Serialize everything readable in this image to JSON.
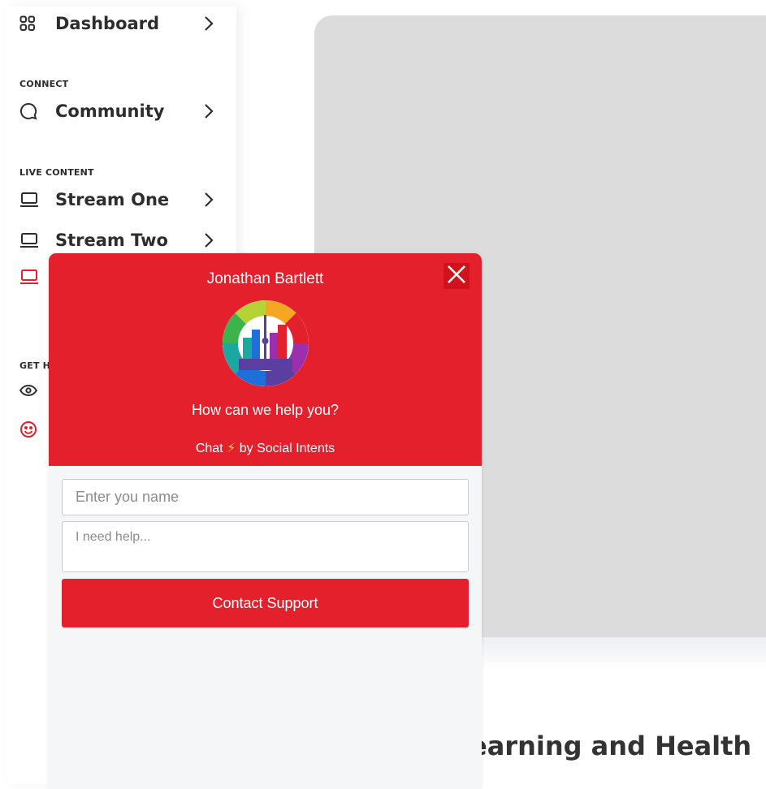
{
  "sidebar": {
    "dashboard": {
      "label": "Dashboard",
      "icon": "grid-icon"
    },
    "connect_label": "CONNECT",
    "community": {
      "label": "Community",
      "icon": "chat-bubble-icon"
    },
    "live_content_label": "LIVE CONTENT",
    "stream_one": {
      "label": "Stream One",
      "icon": "laptop-icon"
    },
    "stream_two": {
      "label": "Stream Two",
      "icon": "laptop-icon"
    },
    "get_help_label": "GET H",
    "accent_color": "#e3202b"
  },
  "chat": {
    "agent_name": "Jonathan Bartlett",
    "help_text": "How can we help you?",
    "powered_prefix": "Chat",
    "powered_suffix": "by Social Intents",
    "name_placeholder": "Enter you name",
    "message_placeholder": "I need help...",
    "contact_button": "Contact Support",
    "brand_color": "#e3202b"
  },
  "main": {
    "heading": "earning and Health"
  }
}
